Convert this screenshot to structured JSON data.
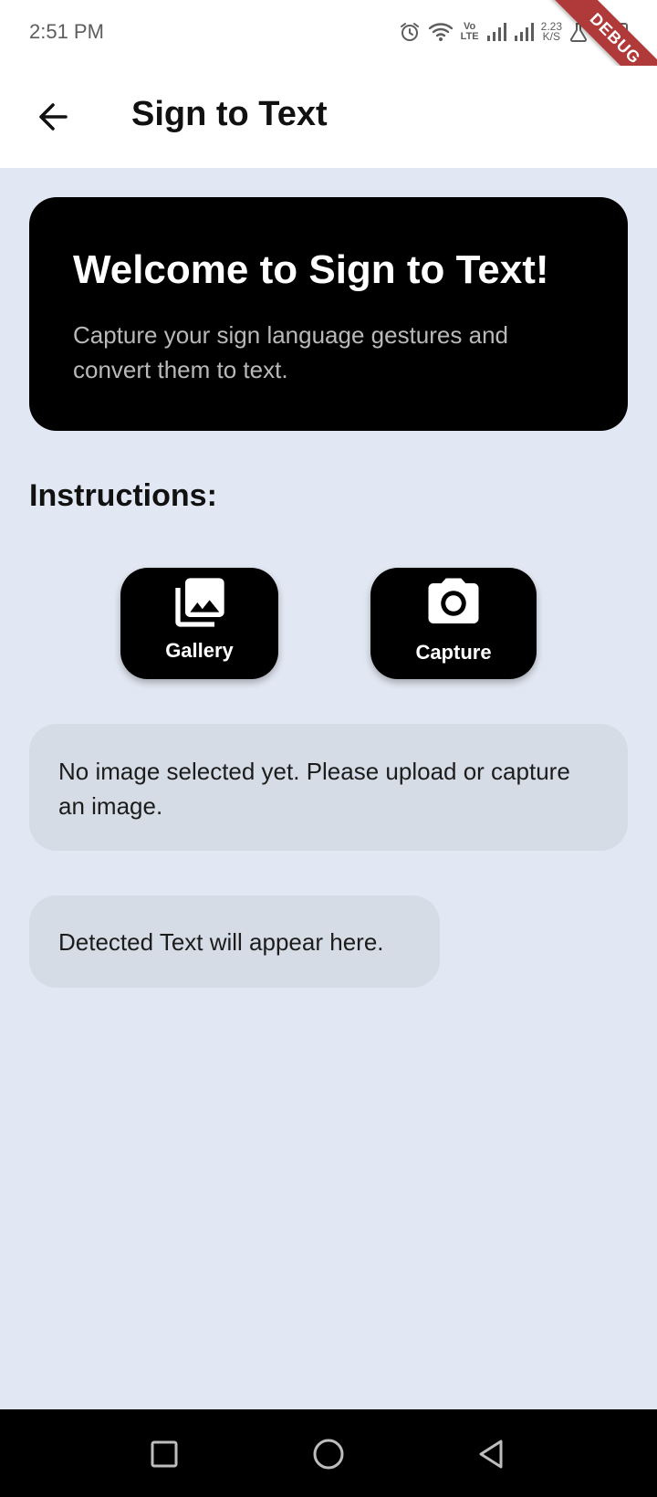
{
  "status_bar": {
    "time": "2:51 PM",
    "volte_top": "Vo",
    "volte_bottom": "LTE",
    "speed_value": "2.23",
    "speed_unit": "K/S",
    "icons": [
      "alarm-icon",
      "wifi-icon",
      "volte-icon",
      "signal-icon",
      "signal-icon",
      "network-speed",
      "flask-icon",
      "battery-icon"
    ],
    "debug_banner": "DEBUG"
  },
  "app_bar": {
    "back_icon": "arrow-left-icon",
    "title": "Sign to Text"
  },
  "welcome_card": {
    "title": "Welcome to Sign to Text!",
    "subtitle": "Capture your sign language gestures and convert them to text."
  },
  "instructions": {
    "title": "Instructions:"
  },
  "actions": {
    "gallery": {
      "label": "Gallery",
      "icon": "photo-library-icon"
    },
    "capture": {
      "label": "Capture",
      "icon": "camera-icon"
    }
  },
  "image_status": {
    "text": "No image selected yet. Please upload or capture an image."
  },
  "detected_text": {
    "text": "Detected Text will appear here."
  },
  "nav_bar": {
    "icons": [
      "recents-icon",
      "home-icon",
      "back-icon"
    ]
  },
  "colors": {
    "background": "#e2e8f3",
    "card": "#000000",
    "info_box": "#d6dce6",
    "debug_ribbon": "#b03a3a"
  }
}
